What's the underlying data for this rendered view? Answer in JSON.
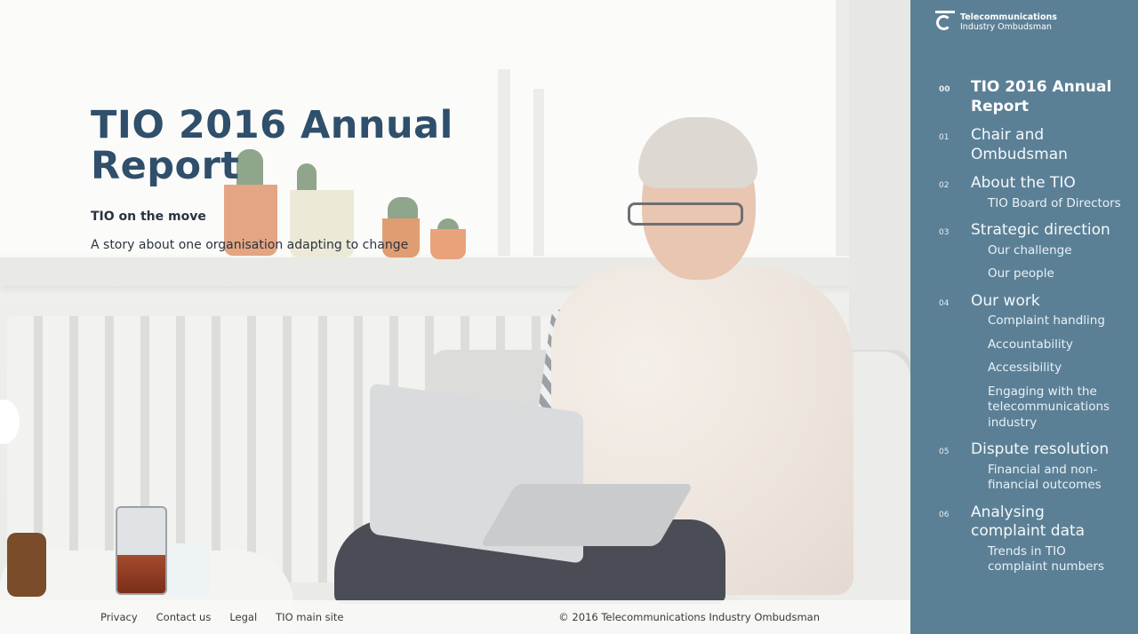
{
  "hero": {
    "title": "TIO 2016 Annual Report",
    "subtitle": "TIO on the move",
    "description": "A story about one organisation adapting to change"
  },
  "footer": {
    "links": [
      "Privacy",
      "Contact us",
      "Legal",
      "TIO main site"
    ],
    "copyright": "© 2016 Telecommunications Industry Ombudsman"
  },
  "brand": {
    "line1": "Telecommunications",
    "line2": "Industry Ombudsman"
  },
  "nav": [
    {
      "num": "00",
      "label": "TIO 2016 Annual Report",
      "active": true,
      "subs": []
    },
    {
      "num": "01",
      "label": "Chair and Ombudsman",
      "subs": []
    },
    {
      "num": "02",
      "label": "About the TIO",
      "subs": [
        "TIO Board of Directors"
      ]
    },
    {
      "num": "03",
      "label": "Strategic direction",
      "subs": [
        "Our challenge",
        "Our people"
      ]
    },
    {
      "num": "04",
      "label": "Our work",
      "subs": [
        "Complaint handling",
        "Accountability",
        "Accessibility",
        "Engaging with the telecommunications industry"
      ]
    },
    {
      "num": "05",
      "label": "Dispute resolution",
      "subs": [
        "Financial and non-financial outcomes"
      ]
    },
    {
      "num": "06",
      "label": "Analysing complaint data",
      "subs": [
        "Trends in TIO complaint numbers"
      ]
    }
  ],
  "colors": {
    "sidebar": "#5b8096",
    "title": "#2f4f6b"
  }
}
